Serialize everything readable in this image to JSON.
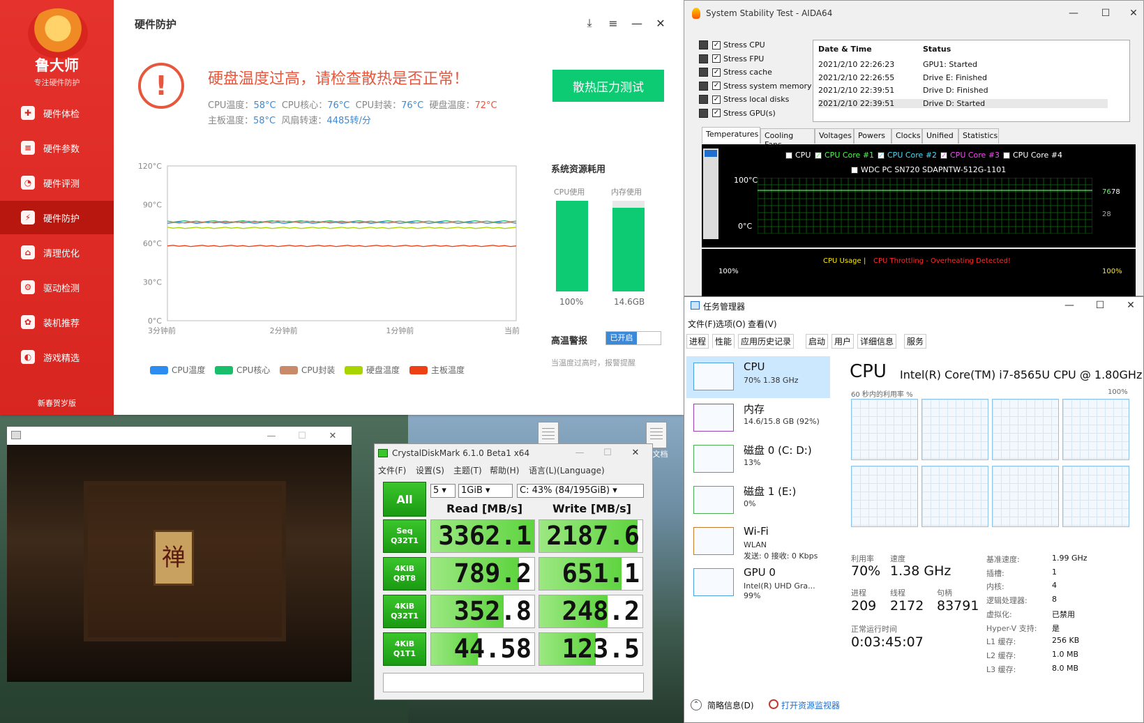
{
  "lds": {
    "brand": "鲁大师",
    "tagline": "专注硬件防护",
    "nav": [
      "硬件体检",
      "硬件参数",
      "硬件评测",
      "硬件防护",
      "清理优化",
      "驱动检测",
      "装机推荐",
      "游戏精选"
    ],
    "active_nav": 3,
    "footer": "新春贺岁版",
    "window_title": "硬件防护",
    "warning": "硬盘温度过高，请检查散热是否正常！",
    "temps": {
      "cpu_temp_label": "CPU温度：",
      "cpu_temp": "58°C",
      "cpu_core_label": "CPU核心：",
      "cpu_core": "76°C",
      "cpu_pkg_label": "CPU封装：",
      "cpu_pkg": "76°C",
      "disk_label": "硬盘温度：",
      "disk": "72°C",
      "board_label": "主板温度：",
      "board": "58°C",
      "fan_label": "风扇转速：",
      "fan": "4485转/分"
    },
    "stress_button": "散热压力测试",
    "chart_y_ticks": [
      "120°C",
      "90°C",
      "60°C",
      "30°C",
      "0°C"
    ],
    "chart_x_ticks": [
      "3分钟前",
      "2分钟前",
      "1分钟前",
      "当前"
    ],
    "legend": [
      "CPU温度",
      "CPU核心",
      "CPU封装",
      "硬盘温度",
      "主板温度"
    ],
    "system_title": "系统资源耗用",
    "cpu_usage_label": "CPU使用",
    "cpu_usage_value": "100%",
    "mem_usage_label": "内存使用",
    "mem_usage_value": "14.6GB",
    "alarm_label": "高温警报",
    "alarm_state": "已开启",
    "alarm_desc": "当温度过高时，报警提醒"
  },
  "chart_data": {
    "type": "line",
    "x": [
      "3分钟前",
      "2分钟前",
      "1分钟前",
      "当前"
    ],
    "ylim": [
      0,
      120
    ],
    "series": [
      {
        "name": "CPU温度",
        "color": "#2d8cf0",
        "values": [
          76,
          76,
          76,
          76
        ]
      },
      {
        "name": "CPU核心",
        "color": "#19be6b",
        "values": [
          77,
          77,
          77,
          77
        ]
      },
      {
        "name": "CPU封装",
        "color": "#c98a6a",
        "values": [
          76,
          77,
          76,
          76
        ]
      },
      {
        "name": "硬盘温度",
        "color": "#a8d400",
        "values": [
          72,
          72,
          72,
          72
        ]
      },
      {
        "name": "主板温度",
        "color": "#ed4014",
        "values": [
          58,
          58,
          58,
          58
        ]
      }
    ]
  },
  "aida": {
    "title": "System Stability Test - AIDA64",
    "stress": [
      "Stress CPU",
      "Stress FPU",
      "Stress cache",
      "Stress system memory",
      "Stress local disks",
      "Stress GPU(s)"
    ],
    "log_headers": [
      "Date & Time",
      "Status"
    ],
    "log": [
      [
        "2021/2/10 22:26:23",
        "GPU1: Started"
      ],
      [
        "2021/2/10 22:26:55",
        "Drive E: Finished"
      ],
      [
        "2021/2/10 22:39:51",
        "Drive D: Finished"
      ],
      [
        "2021/2/10 22:39:51",
        "Drive D: Started"
      ]
    ],
    "tabs": [
      "Temperatures",
      "Cooling Fans",
      "Voltages",
      "Powers",
      "Clocks",
      "Unified",
      "Statistics"
    ],
    "graph_legend": [
      "CPU",
      "CPU Core #1",
      "CPU Core #2",
      "CPU Core #3",
      "CPU Core #4"
    ],
    "graph_legend2": "WDC PC SN720 SDAPNTW-512G-1101",
    "y_top": "100°C",
    "y_bottom": "0°C",
    "right_vals": [
      "76",
      "78",
      "28"
    ],
    "usage_title": "CPU Usage",
    "throttle": "CPU Throttling - Overheating Detected!",
    "usage_left": "100%",
    "usage_right": "100%"
  },
  "tm": {
    "title": "任务管理器",
    "menu": [
      "文件(F)",
      "选项(O)",
      "查看(V)"
    ],
    "tabs": [
      "进程",
      "性能",
      "应用历史记录",
      "启动",
      "用户",
      "详细信息",
      "服务"
    ],
    "side": [
      {
        "t1": "CPU",
        "t2": "70% 1.38 GHz",
        "t3": ""
      },
      {
        "t1": "内存",
        "t2": "14.6/15.8 GB (92%)",
        "t3": ""
      },
      {
        "t1": "磁盘 0 (C: D:)",
        "t2": "13%",
        "t3": ""
      },
      {
        "t1": "磁盘 1 (E:)",
        "t2": "0%",
        "t3": ""
      },
      {
        "t1": "Wi-Fi",
        "t2": "WLAN",
        "t3": "发送: 0 接收: 0 Kbps"
      },
      {
        "t1": "GPU 0",
        "t2": "Intel(R) UHD Gra...",
        "t3": "99%"
      }
    ],
    "cpu_heading": "CPU",
    "cpu_model": "Intel(R) Core(TM) i7-8565U CPU @ 1.80GHz",
    "util_label": "60 秒内的利用率 %",
    "util_max": "100%",
    "stats": {
      "util_l": "利用率",
      "util_v": "70%",
      "speed_l": "速度",
      "speed_v": "1.38 GHz",
      "proc_l": "进程",
      "proc_v": "209",
      "thread_l": "线程",
      "thread_v": "2172",
      "handle_l": "句柄",
      "handle_v": "83791",
      "uptime_l": "正常运行时间",
      "uptime_v": "0:03:45:07"
    },
    "kv": [
      [
        "基准速度:",
        "1.99 GHz"
      ],
      [
        "插槽:",
        "1"
      ],
      [
        "内核:",
        "4"
      ],
      [
        "逻辑处理器:",
        "8"
      ],
      [
        "虚拟化:",
        "已禁用"
      ],
      [
        "Hyper-V 支持:",
        "是"
      ],
      [
        "L1 缓存:",
        "256 KB"
      ],
      [
        "L2 缓存:",
        "1.0 MB"
      ],
      [
        "L3 缓存:",
        "8.0 MB"
      ]
    ],
    "foot_brief": "简略信息(D)",
    "foot_monitor": "打开资源监视器"
  },
  "cdm": {
    "title": "CrystalDiskMark 6.1.0 Beta1 x64",
    "menu": [
      "文件(F)",
      "设置(S)",
      "主题(T)",
      "帮助(H)",
      "语言(L)(Language)"
    ],
    "all": "All",
    "count": "5",
    "size": "1GiB",
    "drive": "C: 43% (84/195GiB)",
    "read_hd": "Read [MB/s]",
    "write_hd": "Write [MB/s]",
    "rows": [
      {
        "l1": "Seq",
        "l2": "Q32T1",
        "read": "3362.1",
        "write": "2187.6",
        "rf": 1.0,
        "wf": 0.95
      },
      {
        "l1": "4KiB",
        "l2": "Q8T8",
        "read": "789.2",
        "write": "651.1",
        "rf": 0.85,
        "wf": 0.8
      },
      {
        "l1": "4KiB",
        "l2": "Q32T1",
        "read": "352.8",
        "write": "248.2",
        "rf": 0.7,
        "wf": 0.66
      },
      {
        "l1": "4KiB",
        "l2": "Q1T1",
        "read": "44.58",
        "write": "123.5",
        "rf": 0.45,
        "wf": 0.55
      }
    ]
  },
  "game": {
    "panel_char": "禅"
  },
  "desktop": {
    "doc_label": "本文档"
  }
}
